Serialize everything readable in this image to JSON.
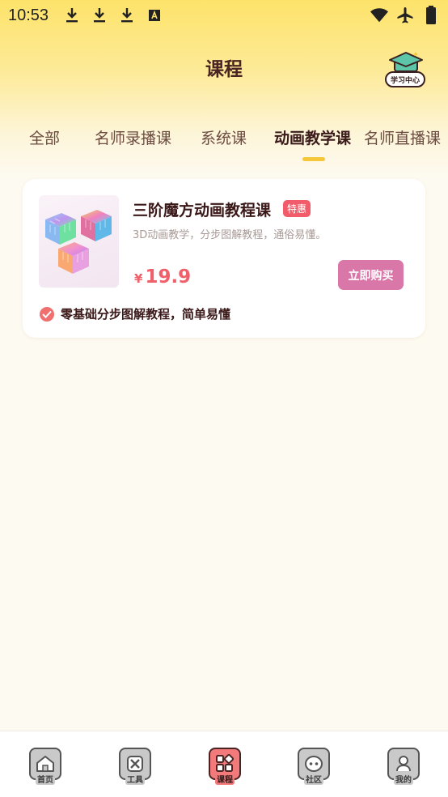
{
  "status_bar": {
    "time": "10:53",
    "icons": [
      "download-icon",
      "download-icon",
      "download-icon",
      "font-icon",
      "wifi-icon",
      "airplane-icon",
      "battery-icon"
    ]
  },
  "header": {
    "title": "课程",
    "study_center_label": "学习中心"
  },
  "tabs": [
    {
      "label": "全部",
      "active": false
    },
    {
      "label": "名师录播课",
      "active": false
    },
    {
      "label": "系统课",
      "active": false
    },
    {
      "label": "动画教学课",
      "active": true
    },
    {
      "label": "名师直播课",
      "active": false
    }
  ],
  "course": {
    "title": "三阶魔方动画教程课",
    "badge": "特惠",
    "description": "3D动画教学，分步图解教程，通俗易懂。",
    "currency": "¥",
    "price": "19.9",
    "buy_label": "立即购买",
    "feature": "零基础分步图解教程，简单易懂"
  },
  "bottom_nav": [
    {
      "label": "首页",
      "icon": "home-icon",
      "active": false
    },
    {
      "label": "工具",
      "icon": "tool-icon",
      "active": false
    },
    {
      "label": "课程",
      "icon": "course-icon",
      "active": true
    },
    {
      "label": "社区",
      "icon": "community-icon",
      "active": false
    },
    {
      "label": "我的",
      "icon": "profile-icon",
      "active": false
    }
  ],
  "colors": {
    "accent": "#f6c73a",
    "price": "#f0606a",
    "buy_button": "#d877a8",
    "badge": "#f25c6a"
  }
}
